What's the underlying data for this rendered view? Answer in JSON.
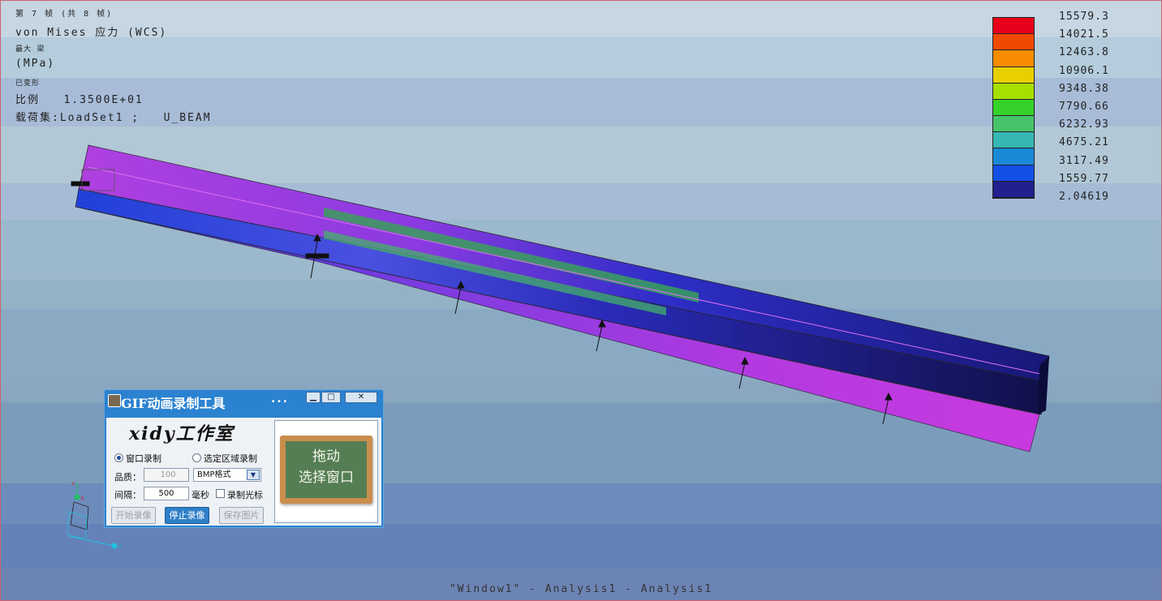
{
  "viewport": {
    "info": {
      "frame": "第 7 帧 (共 8 帧)",
      "quantity": "von Mises 应力 (WCS)",
      "scope": "最大 梁",
      "units": "(MPa)",
      "deformed": "已变形",
      "scale": "比例   1.3500E+01",
      "loadset": "载荷集:LoadSet1 ;   U_BEAM"
    },
    "legend": {
      "values": [
        "15579.3",
        "14021.5",
        "12463.8",
        "10906.1",
        "9348.38",
        "7790.66",
        "6232.93",
        "4675.21",
        "3117.49",
        "1559.77",
        "2.04619"
      ],
      "colors": [
        "#e8001a",
        "#f04a00",
        "#f88c00",
        "#e8d000",
        "#a6e000",
        "#36d22a",
        "#46c46a",
        "#36b6b2",
        "#1a8ad8",
        "#1450e8",
        "#20208e"
      ]
    },
    "footer": "\"Window1\" - Analysis1 - Analysis1",
    "triad": {
      "axis_y": "Y",
      "axis_x": "X",
      "axis_z": "Z"
    },
    "colors": {
      "beam_magenta": "#c03ad8",
      "beam_blue": "#1e2ab8",
      "beam_navy": "#14145a",
      "beam_green": "#3a9a5e"
    }
  },
  "gif_tool": {
    "title": "GIF动画录制工具",
    "title_dots": "...",
    "brand": "xidy工作室",
    "radio_window": "窗口录制",
    "radio_region": "选定区域录制",
    "quality_label": "品质：",
    "quality_value": "100",
    "format_value": "BMP格式",
    "interval_label": "间隔：",
    "interval_value": "500",
    "interval_unit": "毫秒",
    "record_cursor": "录制光标",
    "btn_start": "开始录像",
    "btn_stop": "停止录像",
    "btn_save": "保存图片",
    "board_line1": "拖动",
    "board_line2": "选择窗口"
  }
}
